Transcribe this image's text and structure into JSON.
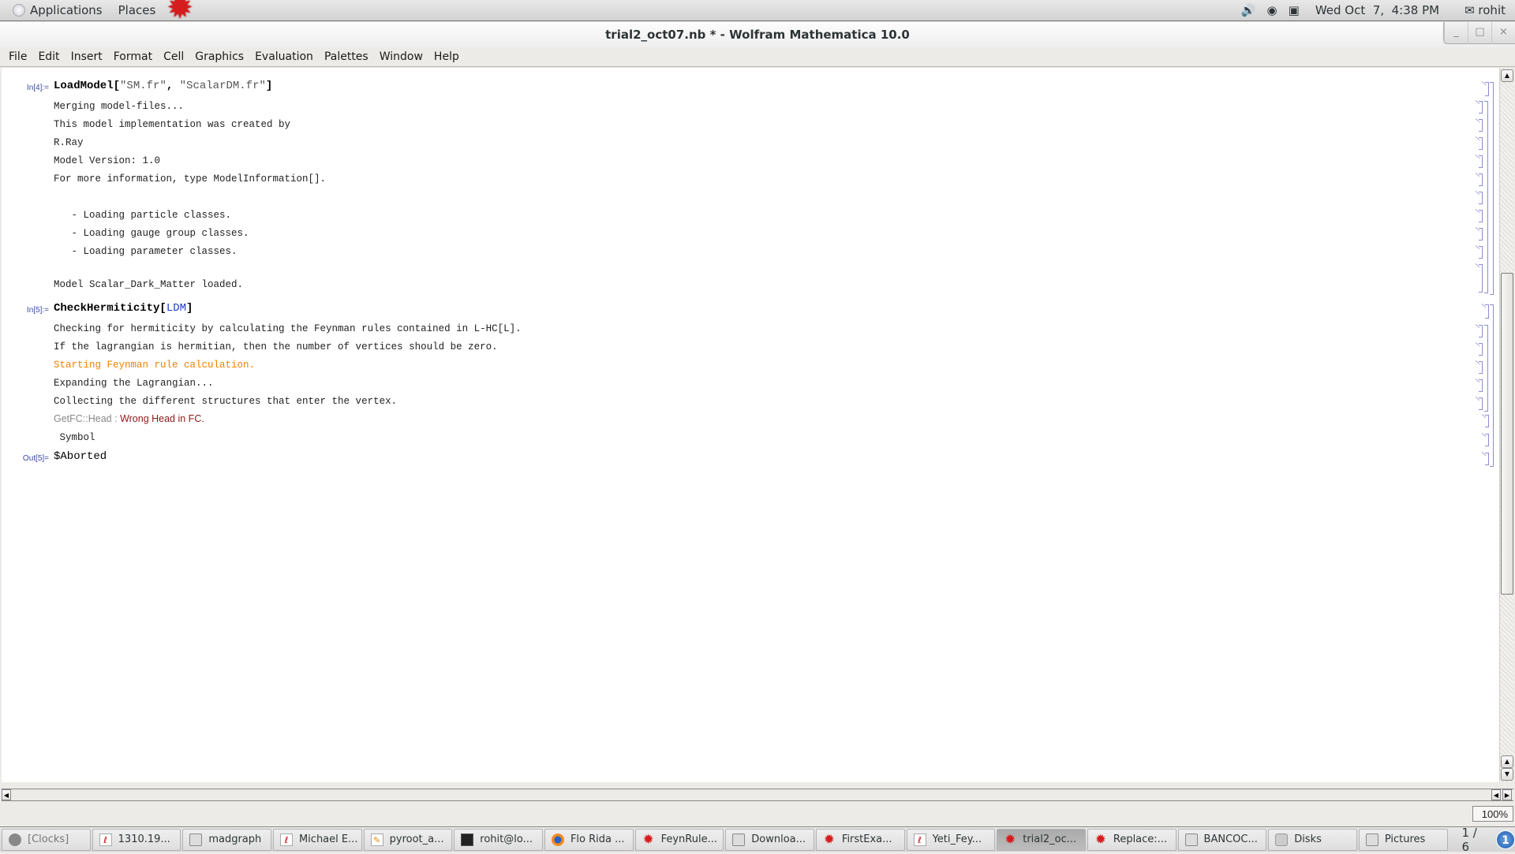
{
  "topbar": {
    "applications": "Applications",
    "places": "Places",
    "datetime": "Wed Oct  7,  4:38 PM",
    "user": "rohit",
    "icons": [
      "volume-icon",
      "headphones-icon",
      "network-icon",
      "chat-icon"
    ]
  },
  "window": {
    "title": "trial2_oct07.nb * - Wolfram Mathematica 10.0",
    "controls": {
      "minimize": "_",
      "maximize": "□",
      "close": "×"
    }
  },
  "menu": [
    "File",
    "Edit",
    "Insert",
    "Format",
    "Cell",
    "Graphics",
    "Evaluation",
    "Palettes",
    "Window",
    "Help"
  ],
  "notebook": {
    "in4": {
      "label": "In[4]:=",
      "func": "LoadModel",
      "open": "[",
      "arg1": "\"SM.fr\"",
      "sep": ", ",
      "arg2": "\"ScalarDM.fr\"",
      "close": "]"
    },
    "prints4": [
      "Merging model-files...",
      "This model implementation was created by",
      "R.Ray",
      "Model Version: 1.0",
      "For more information, type ModelInformation[].",
      "   - Loading particle classes.",
      "   - Loading gauge group classes.",
      "   - Loading parameter classes.",
      "Model Scalar_Dark_Matter loaded."
    ],
    "in5": {
      "label": "In[5]:=",
      "func": "CheckHermiticity",
      "open": "[",
      "arg": "LDM",
      "close": "]"
    },
    "prints5": [
      "Checking for hermiticity by calculating the Feynman rules contained in L-HC[L].",
      "If the lagrangian is hermitian, then the number of vertices should be zero.",
      "Starting Feynman rule calculation.",
      "Expanding the Lagrangian...",
      "Collecting the different structures that enter the vertex."
    ],
    "message": {
      "name": "GetFC::Head",
      "sep": " : ",
      "text": "Wrong Head in FC."
    },
    "symbol_print": " Symbol",
    "out5": {
      "label": "Out[5]=",
      "value": "$Aborted"
    },
    "colors": {
      "highlight_print": "#f08000",
      "message_text": "#8b1a1a",
      "symbol_blue": "#1f3fbf",
      "cell_label": "#3b4aa0"
    }
  },
  "statusbar": {
    "zoom": "100%"
  },
  "taskbar": {
    "tasks": [
      {
        "label": "[Clocks]",
        "icon": "clock-icon",
        "active": false
      },
      {
        "label": "1310.19...",
        "icon": "pdf-icon",
        "active": false
      },
      {
        "label": "madgraph",
        "icon": "folder-icon",
        "active": false
      },
      {
        "label": "Michael E...",
        "icon": "pdf-icon",
        "active": false
      },
      {
        "label": "pyroot_a...",
        "icon": "text-editor-icon",
        "active": false
      },
      {
        "label": "rohit@lo...",
        "icon": "terminal-icon",
        "active": false
      },
      {
        "label": "Flo Rida ...",
        "icon": "firefox-icon",
        "active": false
      },
      {
        "label": "FeynRule...",
        "icon": "mathematica-icon",
        "active": false
      },
      {
        "label": "Downloa...",
        "icon": "folder-icon",
        "active": false
      },
      {
        "label": "FirstExa...",
        "icon": "mathematica-icon",
        "active": false
      },
      {
        "label": "Yeti_Fey...",
        "icon": "pdf-icon",
        "active": false
      },
      {
        "label": "trial2_oc...",
        "icon": "mathematica-icon",
        "active": true
      },
      {
        "label": "Replace:...",
        "icon": "mathematica-icon",
        "active": false
      },
      {
        "label": "BANCOC...",
        "icon": "folder-icon",
        "active": false
      },
      {
        "label": "Disks",
        "icon": "disks-icon",
        "active": false
      },
      {
        "label": "Pictures",
        "icon": "folder-icon",
        "active": false
      }
    ],
    "workspace": "1 / 6",
    "notification_count": "1"
  }
}
